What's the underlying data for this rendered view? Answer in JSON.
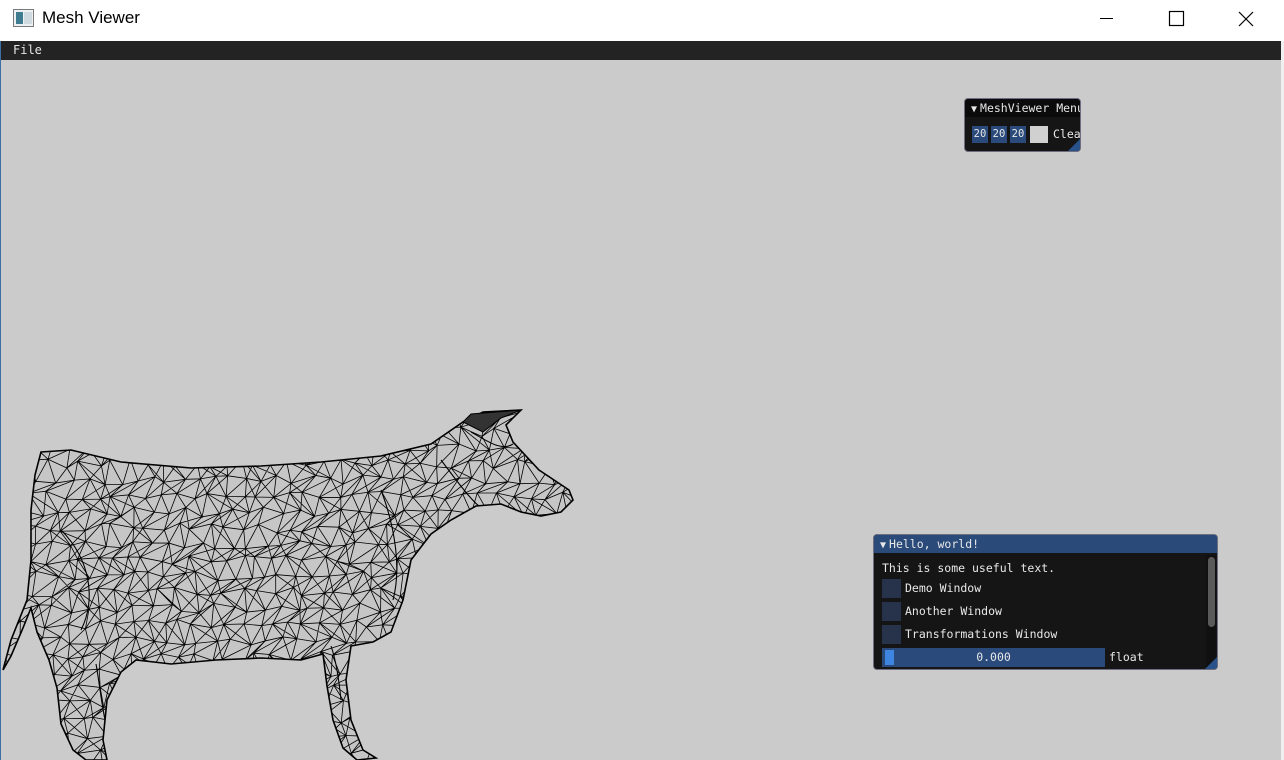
{
  "window": {
    "title": "Mesh Viewer"
  },
  "menubar": {
    "items": [
      "File"
    ]
  },
  "meshviewer_menu": {
    "title": "MeshViewer Menu",
    "drag_values": [
      "20",
      "20",
      "20"
    ],
    "clear_color": "#d0d0d0",
    "clear_label": "Clear"
  },
  "hello_window": {
    "title": "Hello, world!",
    "text": "This is some useful text.",
    "checkboxes": [
      {
        "label": "Demo Window",
        "checked": false
      },
      {
        "label": "Another Window",
        "checked": false
      },
      {
        "label": "Transformations Window",
        "checked": false
      }
    ],
    "slider": {
      "value": "0.000",
      "label": "float",
      "fraction": 0.0
    }
  },
  "colors": {
    "viewport_bg": "#cbcbcb",
    "imgui_accent": "#29528a",
    "title_active": "#2a4a7a"
  },
  "icons": {
    "app": "app-window-icon",
    "minimize": "minimize-icon",
    "maximize": "maximize-icon",
    "close": "close-icon"
  }
}
